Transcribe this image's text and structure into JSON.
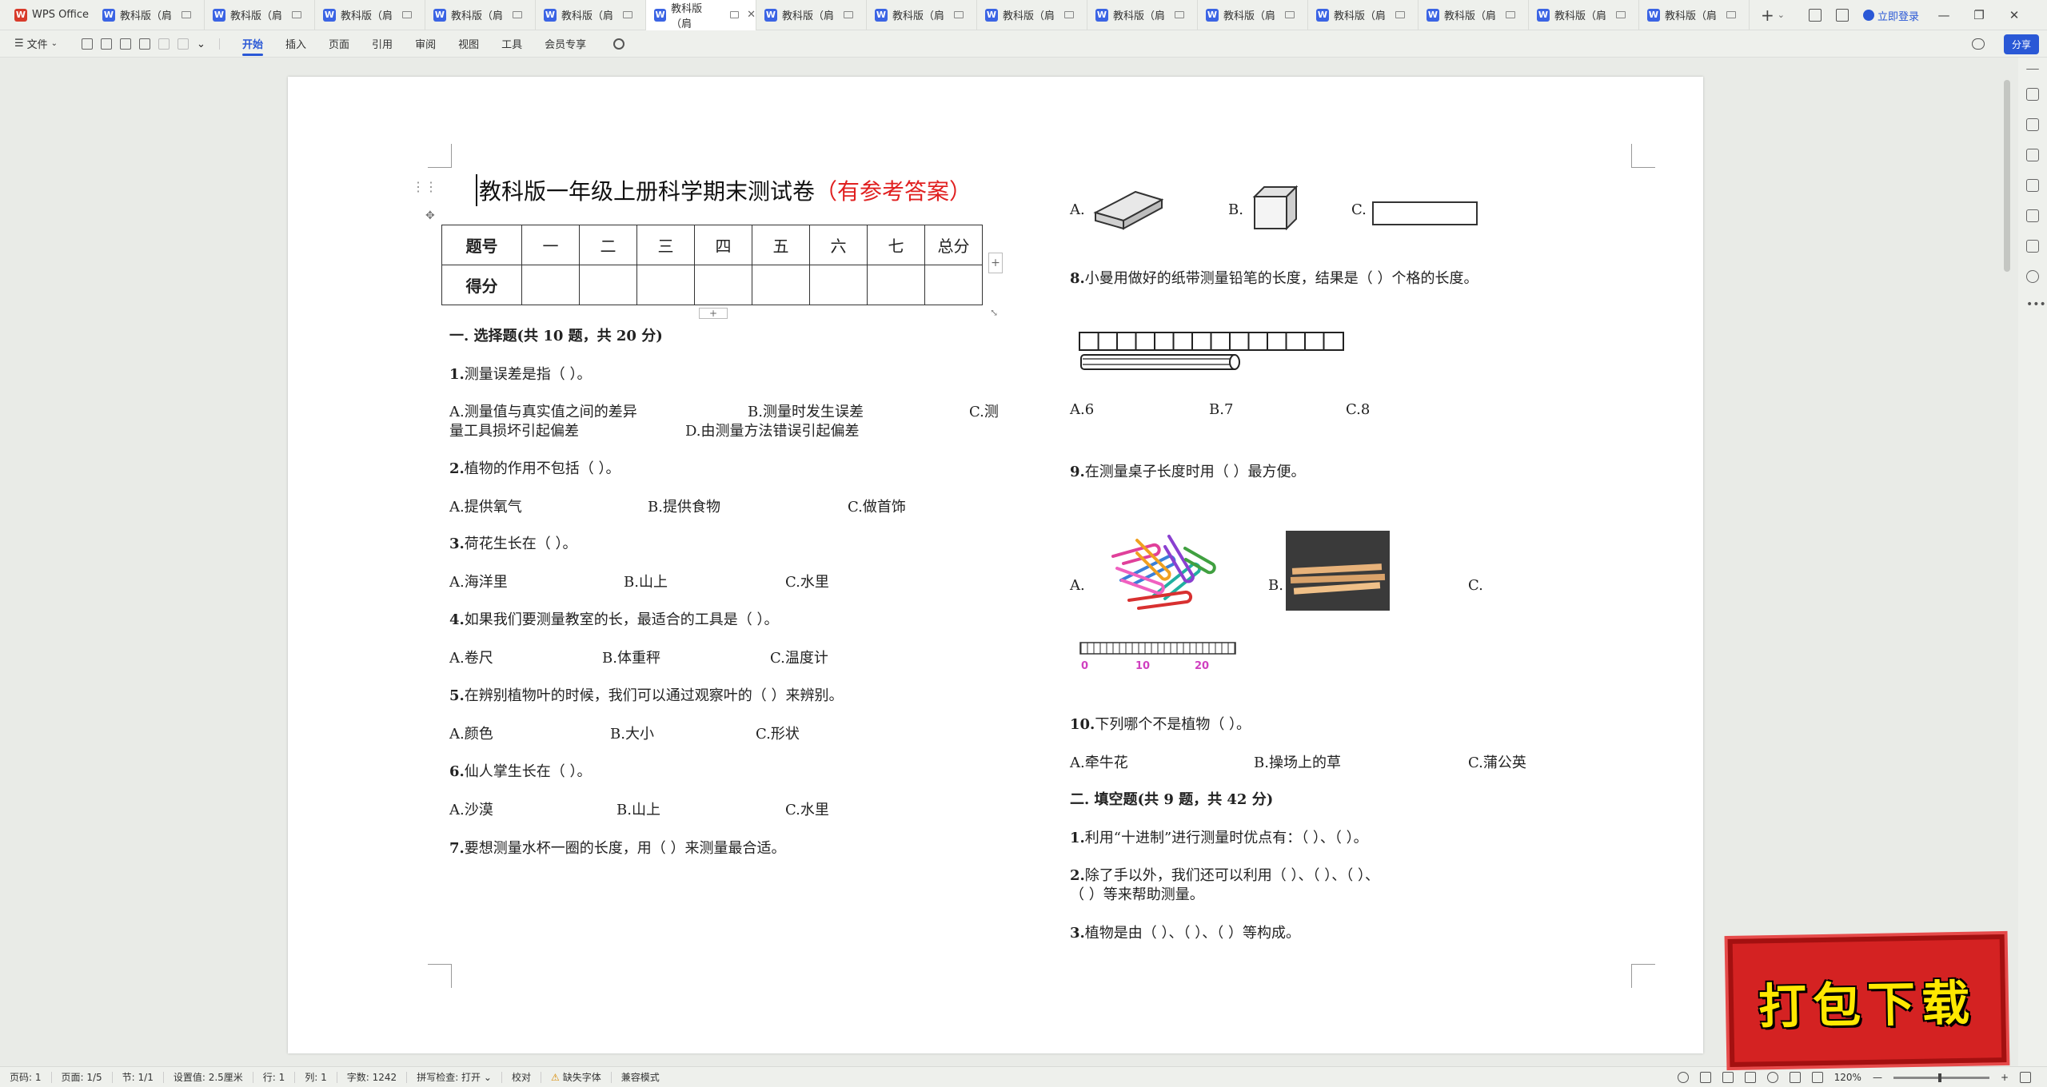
{
  "app": {
    "name": "WPS Office"
  },
  "tabs": [
    {
      "label": "教科版（肩"
    },
    {
      "label": "教科版（肩"
    },
    {
      "label": "教科版（肩"
    },
    {
      "label": "教科版（肩"
    },
    {
      "label": "教科版（肩"
    },
    {
      "label": "教科版（肩",
      "active": true
    },
    {
      "label": "教科版（肩"
    },
    {
      "label": "教科版（肩"
    },
    {
      "label": "教科版（肩"
    },
    {
      "label": "教科版（肩"
    },
    {
      "label": "教科版（肩"
    },
    {
      "label": "教科版（肩"
    },
    {
      "label": "教科版（肩"
    },
    {
      "label": "教科版（肩"
    },
    {
      "label": "教科版（肩"
    }
  ],
  "titlebar": {
    "login": "立即登录",
    "new_tab": "+"
  },
  "menu": {
    "file": "文件",
    "items": [
      "开始",
      "插入",
      "页面",
      "引用",
      "审阅",
      "视图",
      "工具",
      "会员专享"
    ],
    "active": "开始",
    "share": "分享"
  },
  "doc": {
    "title": "教科版一年级上册科学期末测试卷",
    "title_red": "（有参考答案）",
    "score_table": {
      "header": [
        "题号",
        "一",
        "二",
        "三",
        "四",
        "五",
        "六",
        "七",
        "总分"
      ],
      "row2_label": "得分"
    },
    "section1": "一. 选择题(共 10 题，共 20 分)",
    "q1": {
      "num": "1.",
      "text": "测量误差是指（        ）。"
    },
    "q1_opts_line1": {
      "a": "A.测量值与真实值之间的差异",
      "b": "B.测量时发生误差",
      "c": "C.测"
    },
    "q1_opts_line2": {
      "c_cont": "量工具损坏引起偏差",
      "d": "D.由测量方法错误引起偏差"
    },
    "q2": {
      "num": "2.",
      "text": "植物的作用不包括（        ）。"
    },
    "q2_opts": {
      "a": "A.提供氧气",
      "b": "B.提供食物",
      "c": "C.做首饰"
    },
    "q3": {
      "num": "3.",
      "text": "荷花生长在（        ）。"
    },
    "q3_opts": {
      "a": "A.海洋里",
      "b": "B.山上",
      "c": "C.水里"
    },
    "q4": {
      "num": "4.",
      "text": "如果我们要测量教室的长，最适合的工具是（        ）。"
    },
    "q4_opts": {
      "a": "A.卷尺",
      "b": "B.体重秤",
      "c": "C.温度计"
    },
    "q5": {
      "num": "5.",
      "text": "在辨别植物叶的时候，我们可以通过观察叶的（        ）来辨别。"
    },
    "q5_opts": {
      "a": "A.颜色",
      "b": "B.大小",
      "c": "C.形状"
    },
    "q6": {
      "num": "6.",
      "text": "仙人掌生长在（        ）。"
    },
    "q6_opts": {
      "a": "A.沙漠",
      "b": "B.山上",
      "c": "C.水里"
    },
    "q7": {
      "num": "7.",
      "text": "要想测量水杯一圈的长度，用（        ）来测量最合适。"
    },
    "q7_opts": {
      "a": "A.",
      "b": "B.",
      "c": "C."
    },
    "q8": {
      "num": "8.",
      "text": "小曼用做好的纸带测量铅笔的长度，结果是（        ）个格的长度。"
    },
    "q8_opts": {
      "a": "A.6",
      "b": "B.7",
      "c": "C.8"
    },
    "q9": {
      "num": "9.",
      "text": "在测量桌子长度时用（        ）最方便。"
    },
    "q9_opts": {
      "a": "A.",
      "b": "B.",
      "c": "C."
    },
    "ruler_nums": [
      "0",
      "10",
      "20"
    ],
    "q10": {
      "num": "10.",
      "text": "下列哪个不是植物（        ）。"
    },
    "q10_opts": {
      "a": "A.牵牛花",
      "b": "B.操场上的草",
      "c": "C.蒲公英"
    },
    "section2": "二. 填空题(共 9 题，共 42 分)",
    "f1": {
      "num": "1.",
      "text": "利用“十进制”进行测量时优点有：（                ）、（                ）。"
    },
    "f2_line1": {
      "num": "2.",
      "text": "除了手以外，我们还可以利用（                ）、（                ）、（                ）、"
    },
    "f2_line2": "（                ）等来帮助测量。",
    "f3": {
      "num": "3.",
      "text": "植物是由（                ）、（                ）、（                ）等构成。"
    }
  },
  "status": {
    "page_num": "页码: 1",
    "pages": "页面: 1/5",
    "section": "节: 1/1",
    "setting": "设置值: 2.5厘米",
    "row": "行: 1",
    "col": "列: 1",
    "words": "字数: 1242",
    "spell": "拼写检查: 打开",
    "proof": "校对",
    "missing_font": "缺失字体",
    "compat": "兼容模式",
    "zoom": "120%"
  },
  "badge": {
    "text": "打包下载"
  }
}
